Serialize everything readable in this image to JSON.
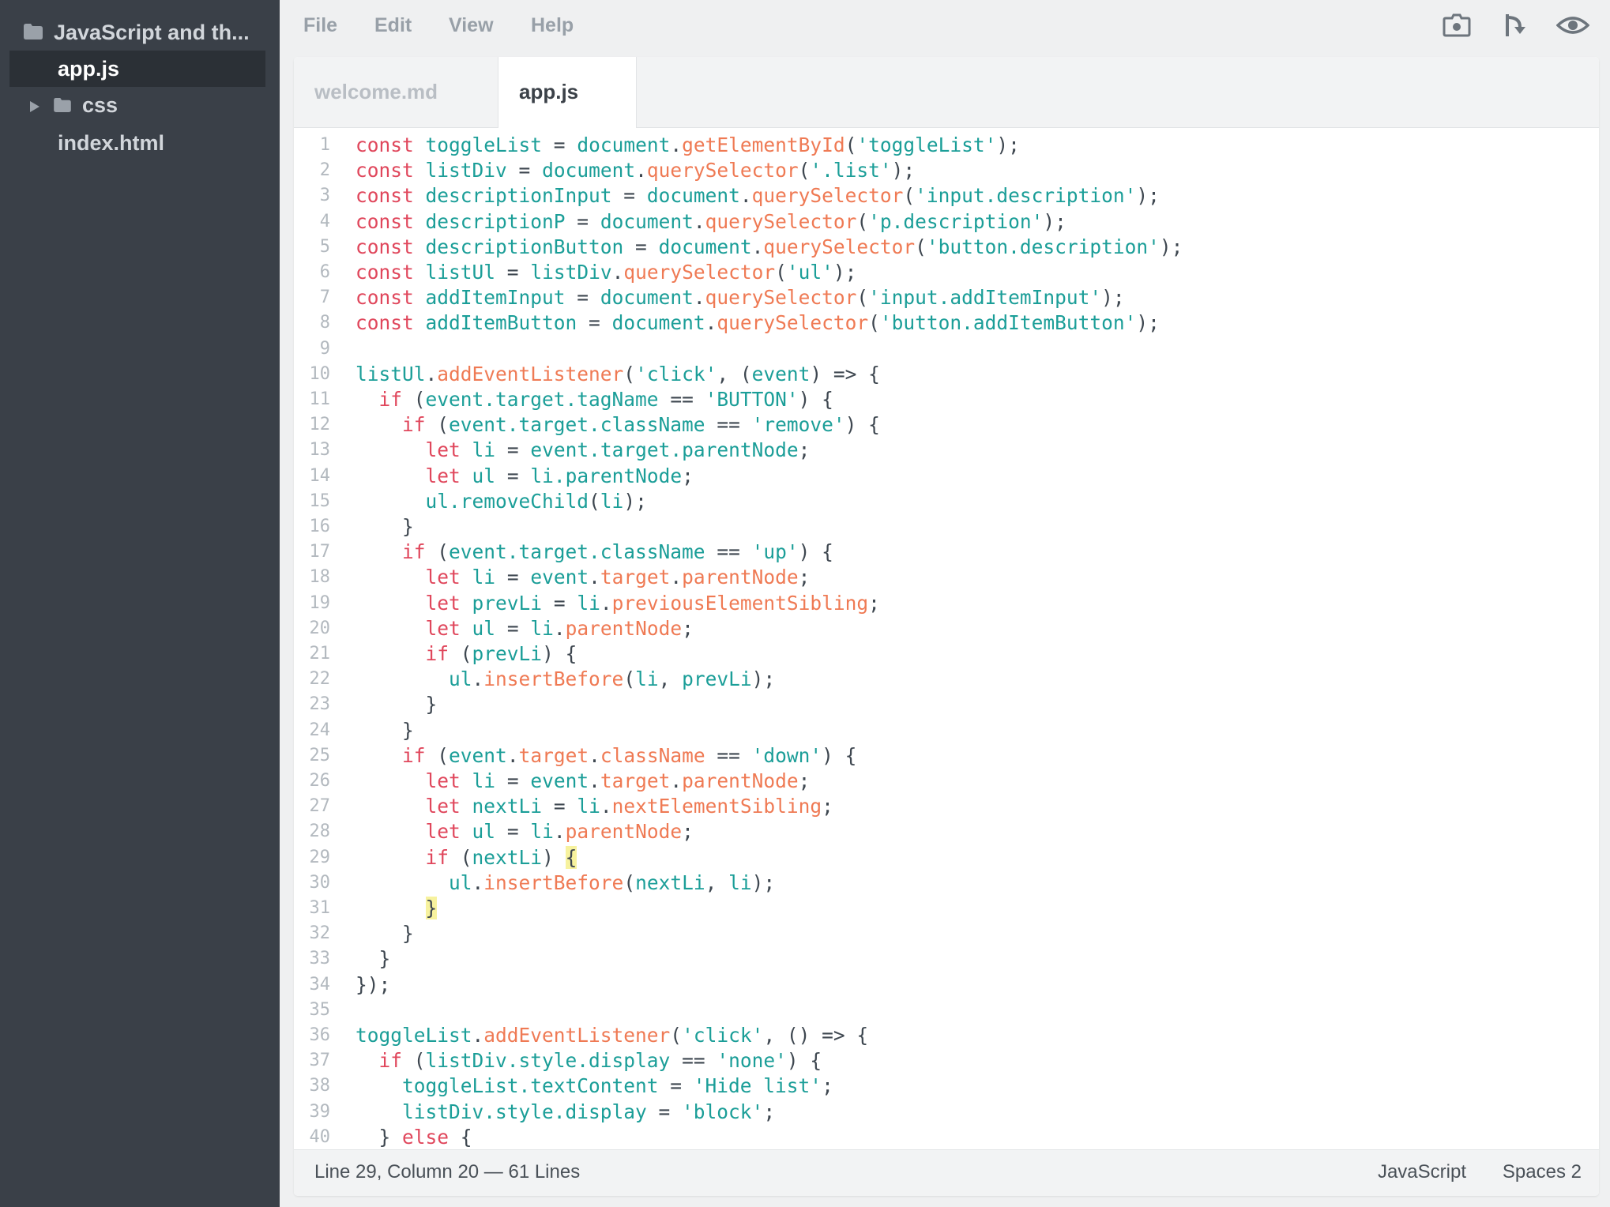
{
  "sidebar": {
    "project": "JavaScript and th...",
    "items": [
      {
        "label": "app.js",
        "type": "file",
        "active": true
      },
      {
        "label": "css",
        "type": "folder",
        "active": false
      },
      {
        "label": "index.html",
        "type": "file",
        "active": false
      }
    ]
  },
  "menu": {
    "items": [
      "File",
      "Edit",
      "View",
      "Help"
    ],
    "tools": [
      "snapshot-camera-icon",
      "share-fork-icon",
      "preview-eye-icon"
    ]
  },
  "tabs": [
    {
      "label": "welcome.md",
      "active": false
    },
    {
      "label": "app.js",
      "active": true
    }
  ],
  "editor": {
    "lines": [
      [
        [
          "kw",
          "const"
        ],
        [
          "p",
          " "
        ],
        [
          "id",
          "toggleList"
        ],
        [
          "p",
          " = "
        ],
        [
          "id",
          "document"
        ],
        [
          "p",
          "."
        ],
        [
          "fn",
          "getElementById"
        ],
        [
          "p",
          "("
        ],
        [
          "str",
          "'toggleList'"
        ],
        [
          "p",
          ");"
        ]
      ],
      [
        [
          "kw",
          "const"
        ],
        [
          "p",
          " "
        ],
        [
          "id",
          "listDiv"
        ],
        [
          "p",
          " = "
        ],
        [
          "id",
          "document"
        ],
        [
          "p",
          "."
        ],
        [
          "fn",
          "querySelector"
        ],
        [
          "p",
          "("
        ],
        [
          "str",
          "'.list'"
        ],
        [
          "p",
          ");"
        ]
      ],
      [
        [
          "kw",
          "const"
        ],
        [
          "p",
          " "
        ],
        [
          "id",
          "descriptionInput"
        ],
        [
          "p",
          " = "
        ],
        [
          "id",
          "document"
        ],
        [
          "p",
          "."
        ],
        [
          "fn",
          "querySelector"
        ],
        [
          "p",
          "("
        ],
        [
          "str",
          "'input.description'"
        ],
        [
          "p",
          ");"
        ]
      ],
      [
        [
          "kw",
          "const"
        ],
        [
          "p",
          " "
        ],
        [
          "id",
          "descriptionP"
        ],
        [
          "p",
          " = "
        ],
        [
          "id",
          "document"
        ],
        [
          "p",
          "."
        ],
        [
          "fn",
          "querySelector"
        ],
        [
          "p",
          "("
        ],
        [
          "str",
          "'p.description'"
        ],
        [
          "p",
          ");"
        ]
      ],
      [
        [
          "kw",
          "const"
        ],
        [
          "p",
          " "
        ],
        [
          "id",
          "descriptionButton"
        ],
        [
          "p",
          " = "
        ],
        [
          "id",
          "document"
        ],
        [
          "p",
          "."
        ],
        [
          "fn",
          "querySelector"
        ],
        [
          "p",
          "("
        ],
        [
          "str",
          "'button.description'"
        ],
        [
          "p",
          ");"
        ]
      ],
      [
        [
          "kw",
          "const"
        ],
        [
          "p",
          " "
        ],
        [
          "id",
          "listUl"
        ],
        [
          "p",
          " = "
        ],
        [
          "id",
          "listDiv"
        ],
        [
          "p",
          "."
        ],
        [
          "fn",
          "querySelector"
        ],
        [
          "p",
          "("
        ],
        [
          "str",
          "'ul'"
        ],
        [
          "p",
          ");"
        ]
      ],
      [
        [
          "kw",
          "const"
        ],
        [
          "p",
          " "
        ],
        [
          "id",
          "addItemInput"
        ],
        [
          "p",
          " = "
        ],
        [
          "id",
          "document"
        ],
        [
          "p",
          "."
        ],
        [
          "fn",
          "querySelector"
        ],
        [
          "p",
          "("
        ],
        [
          "str",
          "'input.addItemInput'"
        ],
        [
          "p",
          ");"
        ]
      ],
      [
        [
          "kw",
          "const"
        ],
        [
          "p",
          " "
        ],
        [
          "id",
          "addItemButton"
        ],
        [
          "p",
          " = "
        ],
        [
          "id",
          "document"
        ],
        [
          "p",
          "."
        ],
        [
          "fn",
          "querySelector"
        ],
        [
          "p",
          "("
        ],
        [
          "str",
          "'button.addItemButton'"
        ],
        [
          "p",
          ");"
        ]
      ],
      [],
      [
        [
          "id",
          "listUl"
        ],
        [
          "p",
          "."
        ],
        [
          "fn",
          "addEventListener"
        ],
        [
          "p",
          "("
        ],
        [
          "str",
          "'click'"
        ],
        [
          "p",
          ", ("
        ],
        [
          "id",
          "event"
        ],
        [
          "p",
          ") => {"
        ]
      ],
      [
        [
          "p",
          "  "
        ],
        [
          "kw",
          "if"
        ],
        [
          "p",
          " ("
        ],
        [
          "id",
          "event.target.tagName"
        ],
        [
          "p",
          " == "
        ],
        [
          "str",
          "'BUTTON'"
        ],
        [
          "p",
          ") {"
        ]
      ],
      [
        [
          "p",
          "    "
        ],
        [
          "kw",
          "if"
        ],
        [
          "p",
          " ("
        ],
        [
          "id",
          "event.target.className"
        ],
        [
          "p",
          " == "
        ],
        [
          "str",
          "'remove'"
        ],
        [
          "p",
          ") {"
        ]
      ],
      [
        [
          "p",
          "      "
        ],
        [
          "kw",
          "let"
        ],
        [
          "p",
          " "
        ],
        [
          "id",
          "li"
        ],
        [
          "p",
          " = "
        ],
        [
          "id",
          "event.target.parentNode"
        ],
        [
          "p",
          ";"
        ]
      ],
      [
        [
          "p",
          "      "
        ],
        [
          "kw",
          "let"
        ],
        [
          "p",
          " "
        ],
        [
          "id",
          "ul"
        ],
        [
          "p",
          " = "
        ],
        [
          "id",
          "li.parentNode"
        ],
        [
          "p",
          ";"
        ]
      ],
      [
        [
          "p",
          "      "
        ],
        [
          "id",
          "ul.removeChild"
        ],
        [
          "p",
          "("
        ],
        [
          "id",
          "li"
        ],
        [
          "p",
          ");"
        ]
      ],
      [
        [
          "p",
          "    }"
        ]
      ],
      [
        [
          "p",
          "    "
        ],
        [
          "kw",
          "if"
        ],
        [
          "p",
          " ("
        ],
        [
          "id",
          "event.target.className"
        ],
        [
          "p",
          " == "
        ],
        [
          "str",
          "'up'"
        ],
        [
          "p",
          ") {"
        ]
      ],
      [
        [
          "p",
          "      "
        ],
        [
          "kw",
          "let"
        ],
        [
          "p",
          " "
        ],
        [
          "id",
          "li"
        ],
        [
          "p",
          " = "
        ],
        [
          "id",
          "event"
        ],
        [
          "p",
          "."
        ],
        [
          "fn",
          "target"
        ],
        [
          "p",
          "."
        ],
        [
          "fn",
          "parentNode"
        ],
        [
          "p",
          ";"
        ]
      ],
      [
        [
          "p",
          "      "
        ],
        [
          "kw",
          "let"
        ],
        [
          "p",
          " "
        ],
        [
          "id",
          "prevLi"
        ],
        [
          "p",
          " = "
        ],
        [
          "id",
          "li"
        ],
        [
          "p",
          "."
        ],
        [
          "fn",
          "previousElementSibling"
        ],
        [
          "p",
          ";"
        ]
      ],
      [
        [
          "p",
          "      "
        ],
        [
          "kw",
          "let"
        ],
        [
          "p",
          " "
        ],
        [
          "id",
          "ul"
        ],
        [
          "p",
          " = "
        ],
        [
          "id",
          "li"
        ],
        [
          "p",
          "."
        ],
        [
          "fn",
          "parentNode"
        ],
        [
          "p",
          ";"
        ]
      ],
      [
        [
          "p",
          "      "
        ],
        [
          "kw",
          "if"
        ],
        [
          "p",
          " ("
        ],
        [
          "id",
          "prevLi"
        ],
        [
          "p",
          ") {"
        ]
      ],
      [
        [
          "p",
          "        "
        ],
        [
          "id",
          "ul"
        ],
        [
          "p",
          "."
        ],
        [
          "fn",
          "insertBefore"
        ],
        [
          "p",
          "("
        ],
        [
          "id",
          "li"
        ],
        [
          "p",
          ", "
        ],
        [
          "id",
          "prevLi"
        ],
        [
          "p",
          ");"
        ]
      ],
      [
        [
          "p",
          "      }"
        ]
      ],
      [
        [
          "p",
          "    }"
        ]
      ],
      [
        [
          "p",
          "    "
        ],
        [
          "kw",
          "if"
        ],
        [
          "p",
          " ("
        ],
        [
          "id",
          "event"
        ],
        [
          "p",
          "."
        ],
        [
          "fn",
          "target"
        ],
        [
          "p",
          "."
        ],
        [
          "fn",
          "className"
        ],
        [
          "p",
          " == "
        ],
        [
          "str",
          "'down'"
        ],
        [
          "p",
          ") {"
        ]
      ],
      [
        [
          "p",
          "      "
        ],
        [
          "kw",
          "let"
        ],
        [
          "p",
          " "
        ],
        [
          "id",
          "li"
        ],
        [
          "p",
          " = "
        ],
        [
          "id",
          "event"
        ],
        [
          "p",
          "."
        ],
        [
          "fn",
          "target"
        ],
        [
          "p",
          "."
        ],
        [
          "fn",
          "parentNode"
        ],
        [
          "p",
          ";"
        ]
      ],
      [
        [
          "p",
          "      "
        ],
        [
          "kw",
          "let"
        ],
        [
          "p",
          " "
        ],
        [
          "id",
          "nextLi"
        ],
        [
          "p",
          " = "
        ],
        [
          "id",
          "li"
        ],
        [
          "p",
          "."
        ],
        [
          "fn",
          "nextElementSibling"
        ],
        [
          "p",
          ";"
        ]
      ],
      [
        [
          "p",
          "      "
        ],
        [
          "kw",
          "let"
        ],
        [
          "p",
          " "
        ],
        [
          "id",
          "ul"
        ],
        [
          "p",
          " = "
        ],
        [
          "id",
          "li"
        ],
        [
          "p",
          "."
        ],
        [
          "fn",
          "parentNode"
        ],
        [
          "p",
          ";"
        ]
      ],
      [
        [
          "p",
          "      "
        ],
        [
          "kw",
          "if"
        ],
        [
          "p",
          " ("
        ],
        [
          "id",
          "nextLi"
        ],
        [
          "p",
          ") "
        ],
        [
          "hl",
          "{"
        ]
      ],
      [
        [
          "p",
          "        "
        ],
        [
          "id",
          "ul"
        ],
        [
          "p",
          "."
        ],
        [
          "fn",
          "insertBefore"
        ],
        [
          "p",
          "("
        ],
        [
          "id",
          "nextLi"
        ],
        [
          "p",
          ", "
        ],
        [
          "id",
          "li"
        ],
        [
          "p",
          ");"
        ]
      ],
      [
        [
          "p",
          "      "
        ],
        [
          "hl",
          "}"
        ]
      ],
      [
        [
          "p",
          "    }"
        ]
      ],
      [
        [
          "p",
          "  }"
        ]
      ],
      [
        [
          "p",
          "});"
        ]
      ],
      [],
      [
        [
          "id",
          "toggleList"
        ],
        [
          "p",
          "."
        ],
        [
          "fn",
          "addEventListener"
        ],
        [
          "p",
          "("
        ],
        [
          "str",
          "'click'"
        ],
        [
          "p",
          ", () => {"
        ]
      ],
      [
        [
          "p",
          "  "
        ],
        [
          "kw",
          "if"
        ],
        [
          "p",
          " ("
        ],
        [
          "id",
          "listDiv.style.display"
        ],
        [
          "p",
          " == "
        ],
        [
          "str",
          "'none'"
        ],
        [
          "p",
          ") {"
        ]
      ],
      [
        [
          "p",
          "    "
        ],
        [
          "id",
          "toggleList.textContent"
        ],
        [
          "p",
          " = "
        ],
        [
          "str",
          "'Hide list'"
        ],
        [
          "p",
          ";"
        ]
      ],
      [
        [
          "p",
          "    "
        ],
        [
          "id",
          "listDiv.style.display"
        ],
        [
          "p",
          " = "
        ],
        [
          "str",
          "'block'"
        ],
        [
          "p",
          ";"
        ]
      ],
      [
        [
          "p",
          "  } "
        ],
        [
          "kw",
          "else"
        ],
        [
          "p",
          " {"
        ]
      ]
    ]
  },
  "status": {
    "position": "Line 29, Column 20 — 61 Lines",
    "language": "JavaScript",
    "spaces": "Spaces  2"
  },
  "colors": {
    "sidebar_bg": "#3a4048",
    "keyword": "#e0475c",
    "identifier": "#1b9e98",
    "method": "#ef7a54",
    "bracket_highlight": "#f7f29e"
  }
}
